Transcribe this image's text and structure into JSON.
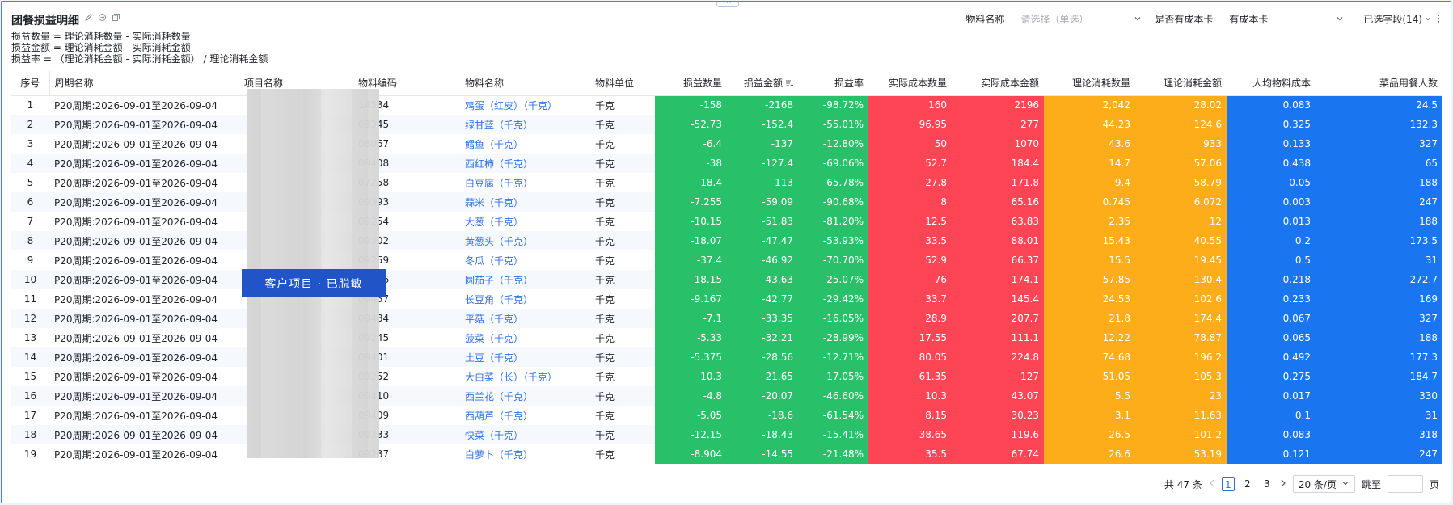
{
  "header": {
    "title": "团餐损益明细",
    "formulas": [
      "损益数量 = 理论消耗数量 - 实际消耗数量",
      "损益金额 = 理论消耗金额 - 实际消耗金额",
      "损益率 = （理论消耗金额 - 实际消耗金额） / 理论消耗金额"
    ]
  },
  "filters": {
    "material_label": "物料名称",
    "material_placeholder": "请选择（单选）",
    "cost_card_label": "是否有成本卡",
    "cost_card_value": "有成本卡",
    "selected_fields": "已选字段(14)"
  },
  "mask": {
    "label": "客户项目 · 已脱敏"
  },
  "table": {
    "columns": [
      "序号",
      "周期名称",
      "项目名称",
      "物料编码",
      "物料名称",
      "物料单位",
      "损益数量",
      "损益金额",
      "损益率",
      "实际成本数量",
      "实际成本金额",
      "理论消耗数量",
      "理论消耗金额",
      "人均物料成本",
      "菜品用餐人数"
    ],
    "rows": [
      [
        "1",
        "P20周期:2026-09-01至2026-09-04",
        "",
        "14534",
        "鸡蛋（红皮）（千克）",
        "千克",
        "-158",
        "-2168",
        "-98.72%",
        "160",
        "2196",
        "2,042",
        "28.02",
        "0.083",
        "24.5"
      ],
      [
        "2",
        "P20周期:2026-09-01至2026-09-04",
        "",
        "09345",
        "绿甘蓝（千克）",
        "千克",
        "-52.73",
        "-152.4",
        "-55.01%",
        "96.95",
        "277",
        "44.23",
        "124.6",
        "0.325",
        "132.3"
      ],
      [
        "3",
        "P20周期:2026-09-01至2026-09-04",
        "",
        "08067",
        "鳕鱼（千克）",
        "千克",
        "-6.4",
        "-137",
        "-12.80%",
        "50",
        "1070",
        "43.6",
        "933",
        "0.133",
        "327"
      ],
      [
        "4",
        "P20周期:2026-09-01至2026-09-04",
        "",
        "09408",
        "西红柿（千克）",
        "千克",
        "-38",
        "-127.4",
        "-69.06%",
        "52.7",
        "184.4",
        "14.7",
        "57.06",
        "0.438",
        "65"
      ],
      [
        "5",
        "P20周期:2026-09-01至2026-09-04",
        "",
        "07258",
        "白豆腐（千克）",
        "千克",
        "-18.4",
        "-113",
        "-65.78%",
        "27.8",
        "171.8",
        "9.4",
        "58.79",
        "0.05",
        "188"
      ],
      [
        "6",
        "P20周期:2026-09-01至2026-09-04",
        "",
        "09393",
        "蒜米（千克）",
        "千克",
        "-7.255",
        "-59.09",
        "-90.68%",
        "8",
        "65.16",
        "0.745",
        "6.072",
        "0.003",
        "247"
      ],
      [
        "7",
        "P20周期:2026-09-01至2026-09-04",
        "",
        "09254",
        "大葱（千克）",
        "千克",
        "-10.15",
        "-51.83",
        "-81.20%",
        "12.5",
        "63.83",
        "2.35",
        "12",
        "0.013",
        "188"
      ],
      [
        "8",
        "P20周期:2026-09-01至2026-09-04",
        "",
        "09302",
        "黄葱头（千克）",
        "千克",
        "-18.07",
        "-47.47",
        "-53.93%",
        "33.5",
        "88.01",
        "15.43",
        "40.55",
        "0.2",
        "173.5"
      ],
      [
        "9",
        "P20周期:2026-09-01至2026-09-04",
        "",
        "09259",
        "冬瓜（千克）",
        "千克",
        "-37.4",
        "-46.92",
        "-70.70%",
        "52.9",
        "66.37",
        "15.5",
        "19.45",
        "0.5",
        "31"
      ],
      [
        "10",
        "P20周期:2026-09-01至2026-09-04",
        "",
        "09456",
        "圆茄子（千克）",
        "千克",
        "-18.15",
        "-43.63",
        "-25.07%",
        "76",
        "174.1",
        "57.85",
        "130.4",
        "0.218",
        "272.7"
      ],
      [
        "11",
        "P20周期:2026-09-01至2026-09-04",
        "",
        "09457",
        "长豆角（千克）",
        "千克",
        "-9.167",
        "-42.77",
        "-29.42%",
        "33.7",
        "145.4",
        "24.53",
        "102.6",
        "0.233",
        "169"
      ],
      [
        "12",
        "P20周期:2026-09-01至2026-09-04",
        "",
        "09484",
        "平菇（千克）",
        "千克",
        "-7.1",
        "-33.35",
        "-16.05%",
        "28.9",
        "207.7",
        "21.8",
        "174.4",
        "0.067",
        "327"
      ],
      [
        "13",
        "P20周期:2026-09-01至2026-09-04",
        "",
        "09245",
        "菠菜（千克）",
        "千克",
        "-5.33",
        "-32.21",
        "-28.99%",
        "17.55",
        "111.1",
        "12.22",
        "78.87",
        "0.065",
        "188"
      ],
      [
        "14",
        "P20周期:2026-09-01至2026-09-04",
        "",
        "09401",
        "土豆（千克）",
        "千克",
        "-5.375",
        "-28.56",
        "-12.71%",
        "80.05",
        "224.8",
        "74.68",
        "196.2",
        "0.492",
        "177.3"
      ],
      [
        "15",
        "P20周期:2026-09-01至2026-09-04",
        "",
        "09252",
        "大白菜（长）（千克）",
        "千克",
        "-10.3",
        "-21.65",
        "-17.05%",
        "61.35",
        "127",
        "51.05",
        "105.3",
        "0.275",
        "184.7"
      ],
      [
        "16",
        "P20周期:2026-09-01至2026-09-04",
        "",
        "09410",
        "西兰花（千克）",
        "千克",
        "-4.8",
        "-20.07",
        "-46.60%",
        "10.3",
        "43.07",
        "5.5",
        "23",
        "0.017",
        "330"
      ],
      [
        "17",
        "P20周期:2026-09-01至2026-09-04",
        "",
        "09409",
        "西葫芦（千克）",
        "千克",
        "-5.05",
        "-18.6",
        "-61.54%",
        "8.15",
        "30.23",
        "3.1",
        "11.63",
        "0.1",
        "31"
      ],
      [
        "18",
        "P20周期:2026-09-01至2026-09-04",
        "",
        "09333",
        "快菜（千克）",
        "千克",
        "-12.15",
        "-18.43",
        "-15.41%",
        "38.65",
        "119.6",
        "26.5",
        "101.2",
        "0.083",
        "318"
      ],
      [
        "19",
        "P20周期:2026-09-01至2026-09-04",
        "",
        "09237",
        "白萝卜（千克）",
        "千克",
        "-8.904",
        "-14.55",
        "-21.48%",
        "35.5",
        "67.74",
        "26.6",
        "53.19",
        "0.121",
        "247"
      ]
    ]
  },
  "pagination": {
    "total": "共 47 条",
    "pages": [
      "1",
      "2",
      "3"
    ],
    "page_size": "20 条/页",
    "goto_label": "跳至",
    "page_suffix": "页"
  }
}
